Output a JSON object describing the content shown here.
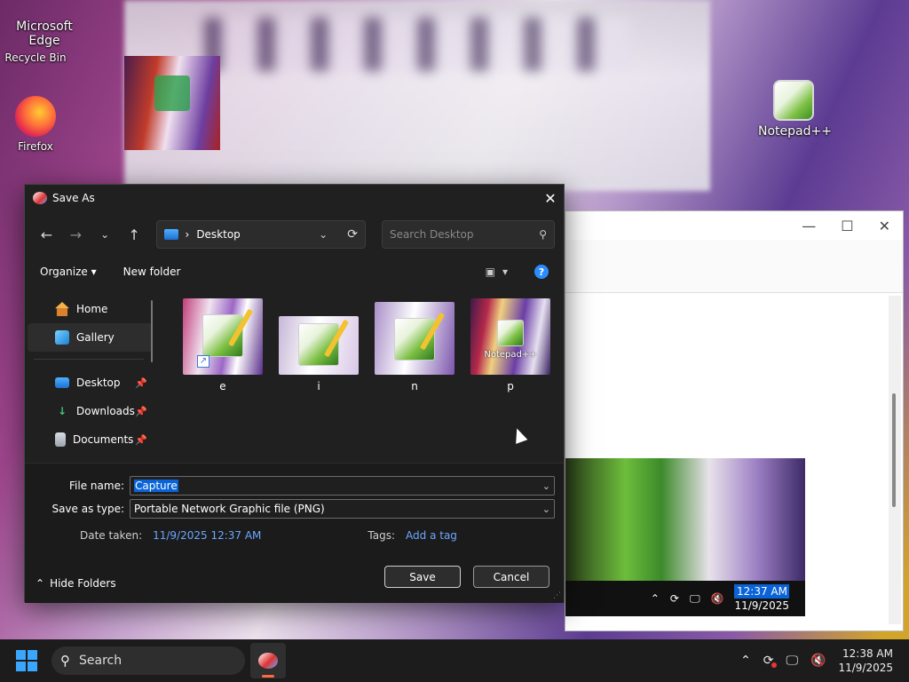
{
  "desktop": {
    "icons": [
      {
        "label": "Recycle Bin"
      },
      {
        "label": "Microsoft Edge"
      },
      {
        "label": "Firefox"
      },
      {
        "label": "Notepad++"
      }
    ]
  },
  "embedded": {
    "time": "12:37 AM",
    "date": "11/9/2025"
  },
  "dialog": {
    "title": "Save As",
    "address": {
      "location": "Desktop"
    },
    "search": {
      "placeholder": "Search Desktop"
    },
    "commands": {
      "organize": "Organize",
      "new_folder": "New folder"
    },
    "sidebar": {
      "items": [
        {
          "label": "Home",
          "icon": "home-icon"
        },
        {
          "label": "Gallery",
          "icon": "gallery-icon"
        },
        {
          "label": "Desktop",
          "icon": "desktop-folder-icon"
        },
        {
          "label": "Downloads",
          "icon": "downloads-icon"
        },
        {
          "label": "Documents",
          "icon": "documents-icon"
        }
      ]
    },
    "files": [
      {
        "name": "e"
      },
      {
        "name": "i"
      },
      {
        "name": "n"
      },
      {
        "name": "p",
        "caption": "Notepad++"
      }
    ],
    "form": {
      "file_name_label": "File name:",
      "file_name_value": "Capture",
      "save_type_label": "Save as type:",
      "save_type_value": "Portable Network Graphic file (PNG)",
      "date_taken_label": "Date taken:",
      "date_taken_value": "11/9/2025 12:37 AM",
      "tags_label": "Tags:",
      "tags_value": "Add a tag"
    },
    "hide_folders": "Hide Folders",
    "save_label": "Save",
    "cancel_label": "Cancel"
  },
  "taskbar": {
    "search_label": "Search",
    "time": "12:38 AM",
    "date": "11/9/2025"
  },
  "colors": {
    "accent": "#0a64d8",
    "link": "#6aa7ff"
  }
}
